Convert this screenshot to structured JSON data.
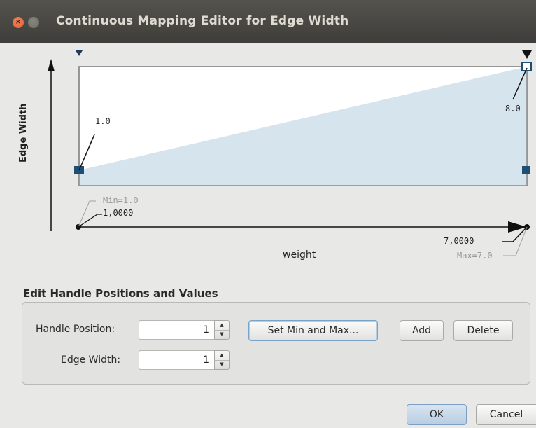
{
  "window": {
    "title": "Continuous Mapping Editor for Edge Width",
    "close_glyph": "×",
    "min_glyph": "–"
  },
  "graph": {
    "y_axis_label": "Edge Width",
    "x_axis_label": "weight",
    "left_value_label": "1.0",
    "right_value_label": "8.0",
    "min_label": "Min=1.0",
    "max_label": "Max=7.0",
    "left_handle_label": "1,0000",
    "right_handle_label": "7,0000",
    "fill_color": "#d6e4ee",
    "handle_color": "#1d4f74"
  },
  "edit": {
    "section_title": "Edit Handle Positions and Values",
    "handle_position_label": "Handle Position:",
    "handle_position_value": "1",
    "edge_width_label": "Edge Width:",
    "edge_width_value": "1",
    "set_min_max_button": "Set Min and Max...",
    "add_button": "Add",
    "delete_button": "Delete"
  },
  "footer": {
    "ok_button": "OK",
    "cancel_button": "Cancel"
  }
}
